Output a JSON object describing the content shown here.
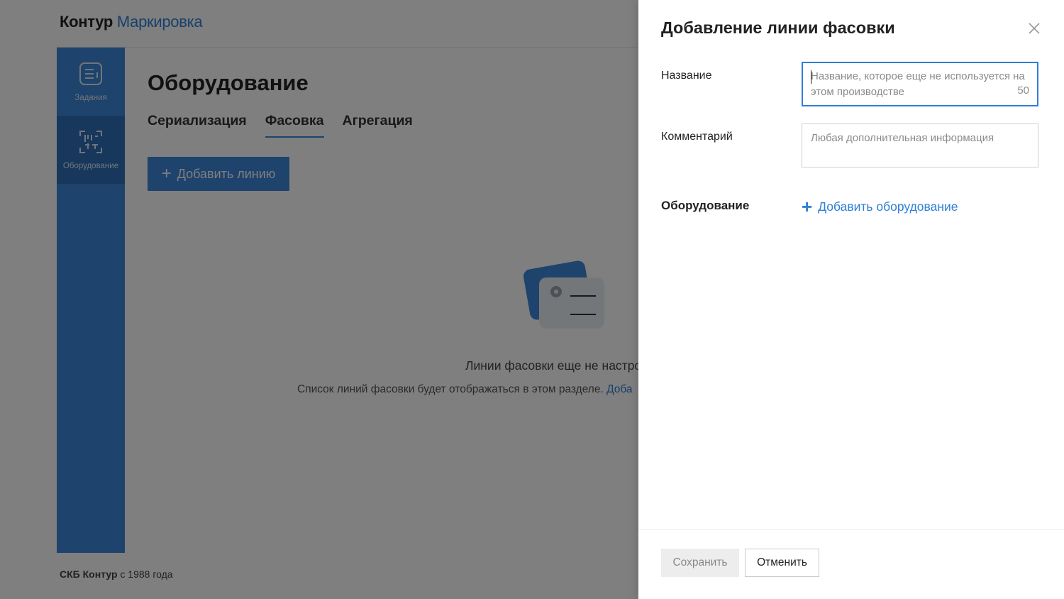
{
  "header": {
    "brand": "Контур",
    "product": "Маркировка"
  },
  "sidebar": {
    "items": [
      {
        "label": "Задания",
        "icon": "tasks-list-icon"
      },
      {
        "label": "Оборудование",
        "icon": "equipment-barcode-icon"
      }
    ]
  },
  "main": {
    "title": "Оборудование",
    "tabs": [
      {
        "label": "Сериализация"
      },
      {
        "label": "Фасовка"
      },
      {
        "label": "Агрегация"
      }
    ],
    "add_line_button": "Добавить линию",
    "empty_title": "Линии фасовки еще не настро",
    "empty_sub": "Список линий фасовки будет отображаться в этом разделе. ",
    "empty_link": "Доба"
  },
  "footer": {
    "company": "СКБ Контур",
    "since": " с 1988 года"
  },
  "panel": {
    "title": "Добавление линии фасовки",
    "name_label": "Название",
    "name_placeholder": "Название, которое еще не используется на этом производстве",
    "name_counter": "50",
    "comment_label": "Комментарий",
    "comment_placeholder": "Любая дополнительная информация",
    "equipment_label": "Оборудование",
    "add_equipment": "Добавить оборудование",
    "save_button": "Сохранить",
    "cancel_button": "Отменить"
  },
  "colors": {
    "accent": "#3d86d9",
    "link": "#2f7fd6",
    "overlay": "rgba(0,0,0,0.5)"
  }
}
